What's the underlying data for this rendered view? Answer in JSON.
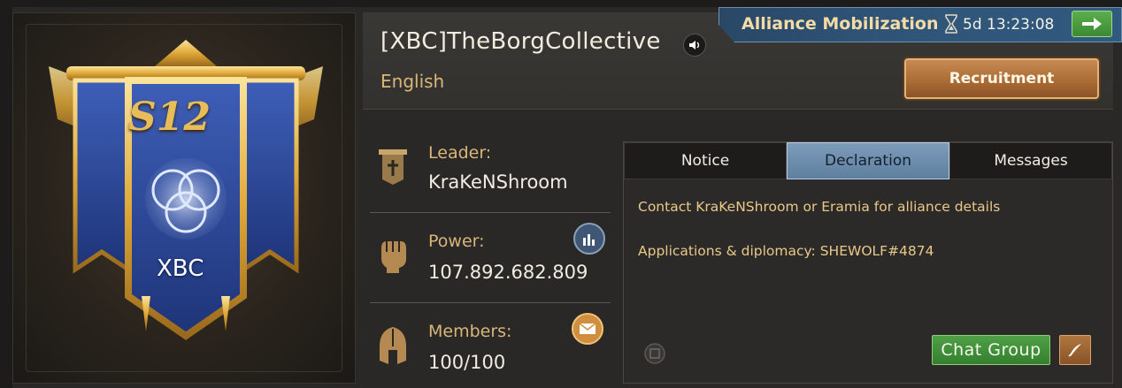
{
  "emblem": {
    "season": "S12",
    "tag": "XBC"
  },
  "header": {
    "alliance_name": "[XBC]TheBorgCollective",
    "language": "English",
    "recruit_label": "Recruitment"
  },
  "mobilization": {
    "title": "Alliance Mobilization",
    "timer": "5d 13:23:08"
  },
  "stats": {
    "leader_label": "Leader:",
    "leader_value": "KraKeNShroom",
    "power_label": "Power:",
    "power_value": "107.892.682.809",
    "members_label": "Members:",
    "members_value": "100/100"
  },
  "tabs": [
    {
      "label": "Notice"
    },
    {
      "label": "Declaration"
    },
    {
      "label": "Messages"
    }
  ],
  "active_tab": "Declaration",
  "declaration": {
    "line1": "Contact KraKeNShroom or Eramia for alliance details",
    "line2": "Applications & diplomacy: SHEWOLF#4874"
  },
  "actions": {
    "chat_group_label": "Chat Group"
  },
  "icons": {
    "speaker": "speaker-icon",
    "hourglass": "hourglass-icon",
    "arrow": "arrow-right-icon",
    "leader": "leader-banner-icon",
    "power": "fist-icon",
    "members": "helmet-icon",
    "stats": "bar-chart-icon",
    "mail": "mail-icon",
    "translate": "translate-icon",
    "edit": "quill-icon"
  },
  "colors": {
    "gold_text": "#d8b679",
    "active_tab": "#6f8fae",
    "chat_button": "#3f8f38",
    "recruit_button": "#a96a33"
  }
}
